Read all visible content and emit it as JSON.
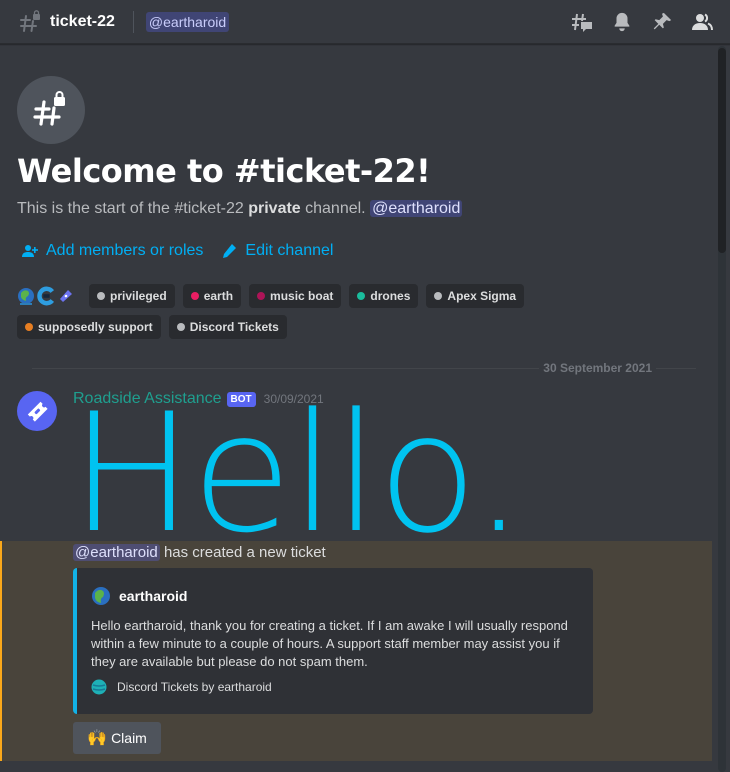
{
  "header": {
    "channel_name": "ticket-22",
    "topic_mention": "@eartharoid",
    "icons": [
      "threads-icon",
      "notification-bell-icon",
      "pinned-messages-icon",
      "member-list-icon"
    ]
  },
  "welcome": {
    "icon": "private-channel-hash-lock-icon",
    "title": "Welcome to #ticket-22!",
    "subtitle_prefix": "This is the start of the #ticket-22 ",
    "subtitle_bold": "private",
    "subtitle_suffix": " channel. ",
    "subtitle_mention": "@eartharoid",
    "actions": [
      {
        "label": "Add members or roles",
        "icon": "add-member-icon"
      },
      {
        "label": "Edit channel",
        "icon": "pencil-icon"
      }
    ]
  },
  "roles": {
    "member_icons": [
      "earth-globe-avatar",
      "c-logo-avatar",
      "ticket-avatar"
    ],
    "items": [
      {
        "label": "privileged",
        "color": "#b9bbbe"
      },
      {
        "label": "earth",
        "color": "#e91e63"
      },
      {
        "label": "music boat",
        "color": "#ad1457"
      },
      {
        "label": "drones",
        "color": "#1abc9c"
      },
      {
        "label": "Apex Sigma",
        "color": "#b9bbbe"
      },
      {
        "label": "supposedly support",
        "color": "#e67e22"
      },
      {
        "label": "Discord Tickets",
        "color": "#b9bbbe"
      }
    ]
  },
  "date_divider": "30 September 2021",
  "message": {
    "author": "Roadside Assistance",
    "author_color": "#1f9f8f",
    "bot_tag": "BOT",
    "timestamp": "30/09/2021",
    "big_text": "Hello.",
    "big_text_color": "#00c3f0"
  },
  "ticket_message": {
    "mention": "@eartharoid",
    "text": " has created a new ticket",
    "embed": {
      "accent_color": "#12b2e6",
      "author_name": "eartharoid",
      "description": "Hello eartharoid, thank you for creating a ticket. If I am awake I will usually respond within a few minute to a couple of hours. A support staff member may assist you if they are available but please do not spam them.",
      "footer": "Discord Tickets by eartharoid"
    },
    "button": {
      "emoji": "🙌",
      "label": "Claim"
    }
  }
}
